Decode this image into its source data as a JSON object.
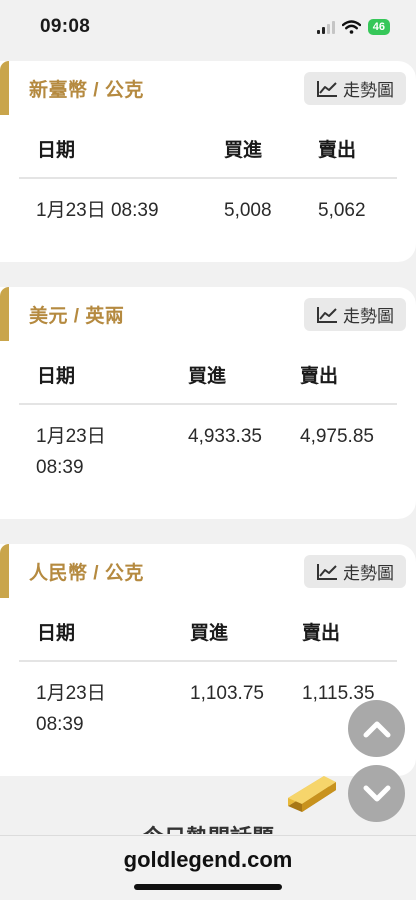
{
  "status_bar": {
    "time": "09:08",
    "battery": "46"
  },
  "cards": [
    {
      "title": "新臺幣 / 公克",
      "trend_label": "走勢圖",
      "headers": {
        "date": "日期",
        "buy": "買進",
        "sell": "賣出"
      },
      "row": {
        "date_line1": "1月23日 08:39",
        "date_line2": "",
        "buy": "5,008",
        "sell": "5,062"
      }
    },
    {
      "title": "美元 / 英兩",
      "trend_label": "走勢圖",
      "headers": {
        "date": "日期",
        "buy": "買進",
        "sell": "賣出"
      },
      "row": {
        "date_line1": "1月23日",
        "date_line2": "08:39",
        "buy": "4,933.35",
        "sell": "4,975.85"
      }
    },
    {
      "title": "人民幣 / 公克",
      "trend_label": "走勢圖",
      "headers": {
        "date": "日期",
        "buy": "買進",
        "sell": "賣出"
      },
      "row": {
        "date_line1": "1月23日",
        "date_line2": "08:39",
        "buy": "1,103.75",
        "sell": "1,115.35"
      }
    }
  ],
  "section_heading": "今日熱門話題",
  "browser": {
    "url": "goldlegend.com"
  },
  "colors": {
    "accent": "#c9a54b",
    "title": "#b58a40",
    "fab": "#a9a9a9",
    "battery": "#36c759"
  },
  "icons": [
    "chart-line-icon",
    "chevron-up-icon",
    "chevron-down-icon",
    "gold-bar-icon",
    "wifi-icon",
    "signal-icon"
  ]
}
